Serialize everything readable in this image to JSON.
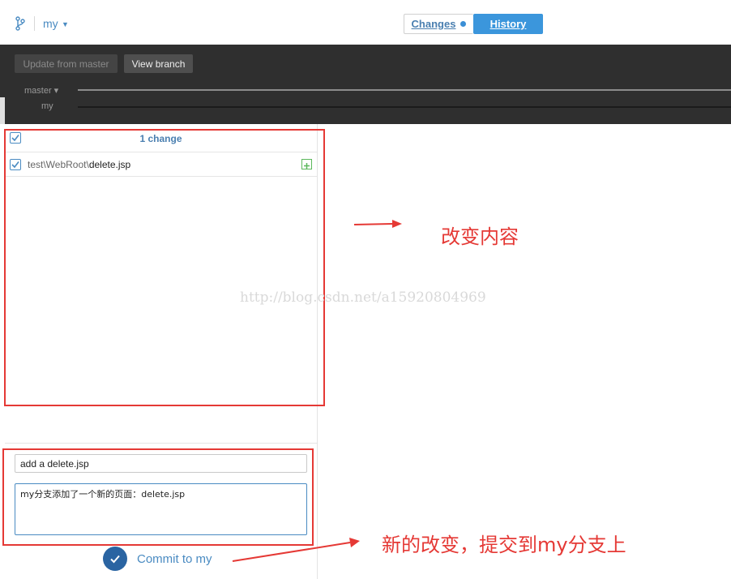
{
  "topbar": {
    "branch": "my",
    "tabs": {
      "changes_label": "Changes",
      "history_label": "History"
    }
  },
  "toolbar": {
    "update_label": "Update from master",
    "view_branch_label": "View branch"
  },
  "lanes": [
    "master",
    "my"
  ],
  "changes": {
    "count_label": "1 change",
    "files": [
      {
        "dir": "test\\WebRoot\\",
        "name": "delete.jsp",
        "status": "added"
      }
    ]
  },
  "commit": {
    "summary_value": "add a delete.jsp",
    "description_value": "my分支添加了一个新的页面：delete.jsp",
    "button_label": "Commit to my"
  },
  "annotations": {
    "note_changes": "改变内容",
    "note_commit": "新的改变，提交到my分支上",
    "watermark": "http://blog.csdn.net/a15920804969"
  },
  "colors": {
    "accent": "#3b96dc",
    "annotation_red": "#e53935",
    "dark_panel": "#2f2f2f"
  }
}
